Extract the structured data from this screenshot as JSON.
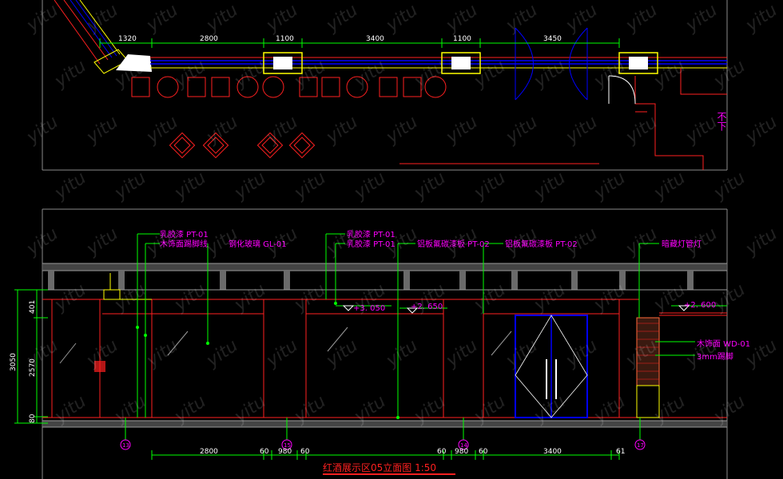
{
  "plan_dims": {
    "top": [
      "1320",
      "2800",
      "1100",
      "3400",
      "1100",
      "3450"
    ]
  },
  "plan_sign": "不下",
  "labels": {
    "latex1": "乳胶漆 PT-01",
    "wood_skirt": "木饰面踢脚线",
    "glass": "钢化玻璃 GL-01",
    "latex2": "乳胶漆 PT-01",
    "latex3": "乳胶漆 PT-01",
    "alu1": "铝板氟碳漆板 PT-02",
    "alu2": "铝板氟碳漆板 PT-02",
    "led": "暗藏灯管灯",
    "wood_right": "木饰面 WD-01",
    "skirt_right": "3mm踢脚"
  },
  "levels": {
    "l1": "+3. 050",
    "l2": "+2. 650",
    "l3": "+2. 600"
  },
  "vdims": {
    "total": "3050",
    "d1": "401",
    "d2": "2570",
    "d3": "80"
  },
  "bottom_dims": [
    "2800",
    "60",
    "980",
    "60",
    "60",
    "980",
    "60",
    "3400",
    "61"
  ],
  "grid_marks": [
    "13",
    "15",
    "14",
    "17"
  ],
  "title": "红酒展示区05立面图  1:50",
  "watermark": "yitu",
  "colors": {
    "bg": "#000000",
    "wall": "#ff2020",
    "glass": "#0000ff",
    "dim": "#00ff00",
    "label": "#ff00ff",
    "yellow": "#ffff00",
    "white": "#ffffff",
    "gray": "#8a8a8a"
  }
}
